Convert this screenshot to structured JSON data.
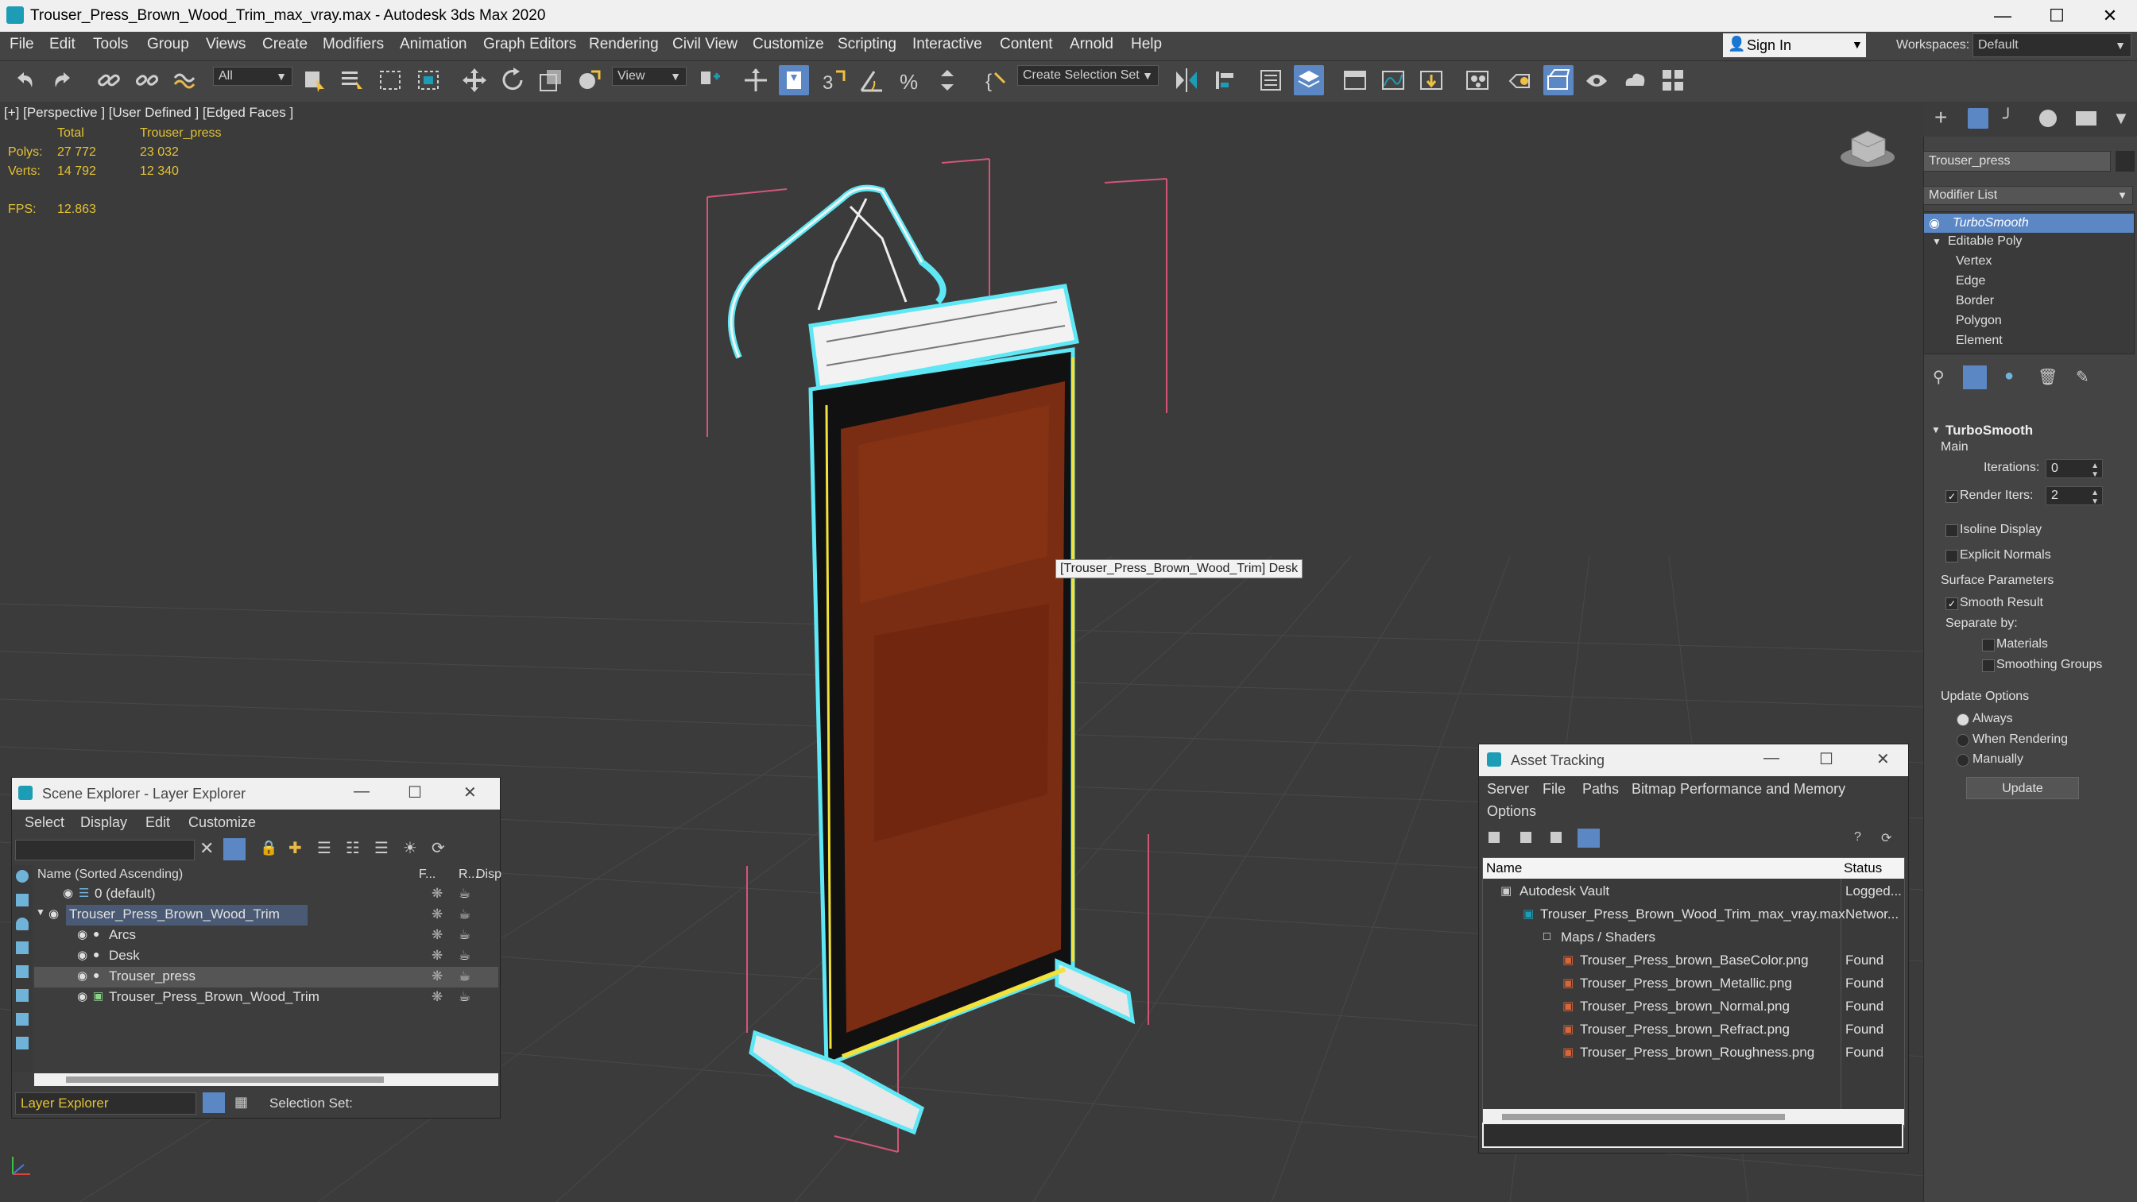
{
  "titlebar": {
    "title": "Trouser_Press_Brown_Wood_Trim_max_vray.max - Autodesk 3ds Max 2020"
  },
  "menu": [
    "File",
    "Edit",
    "Tools",
    "Group",
    "Views",
    "Create",
    "Modifiers",
    "Animation",
    "Graph Editors",
    "Rendering",
    "Civil View",
    "Customize",
    "Scripting",
    "Interactive",
    "Content",
    "Arnold",
    "Help"
  ],
  "account": {
    "sign_in": "Sign In",
    "workspaces_label": "Workspaces:",
    "workspace_value": "Default"
  },
  "toolbar": {
    "filter_value": "All",
    "ref_coord": "View",
    "selection_set_placeholder": "Create Selection Set"
  },
  "viewport": {
    "label": "[+] [Perspective ] [User Defined ] [Edged Faces ]",
    "stats": {
      "col_total": "Total",
      "col_object": "Trouser_press",
      "polys_label": "Polys:",
      "polys_total": "27 772",
      "polys_object": "23 032",
      "verts_label": "Verts:",
      "verts_total": "14 792",
      "verts_object": "12 340",
      "fps_label": "FPS:",
      "fps_value": "12.863"
    },
    "tooltip": "[Trouser_Press_Brown_Wood_Trim] Desk"
  },
  "command_panel": {
    "object_name": "Trouser_press",
    "modifier_list": "Modifier List",
    "stack": [
      "TurboSmooth",
      "Editable Poly",
      "Vertex",
      "Edge",
      "Border",
      "Polygon",
      "Element"
    ],
    "rollout_title": "TurboSmooth",
    "main_label": "Main",
    "iterations_label": "Iterations:",
    "iterations_value": "0",
    "render_iters_label": "Render Iters:",
    "render_iters_value": "2",
    "isoline_label": "Isoline Display",
    "explicit_normals_label": "Explicit Normals",
    "surface_params_label": "Surface Parameters",
    "smooth_result_label": "Smooth Result",
    "separate_by_label": "Separate by:",
    "materials_label": "Materials",
    "smoothing_groups_label": "Smoothing Groups",
    "update_options_label": "Update Options",
    "always_label": "Always",
    "when_rendering_label": "When Rendering",
    "manually_label": "Manually",
    "update_button": "Update"
  },
  "scene_explorer": {
    "title": "Scene Explorer - Layer Explorer",
    "menu": [
      "Select",
      "Display",
      "Edit",
      "Customize"
    ],
    "col_name": "Name (Sorted Ascending)",
    "col_f": "F...",
    "col_r": "R...",
    "col_disp": "Disp",
    "rows": [
      {
        "label": "0 (default)"
      },
      {
        "label": "Trouser_Press_Brown_Wood_Trim"
      },
      {
        "label": "Arcs"
      },
      {
        "label": "Desk"
      },
      {
        "label": "Trouser_press"
      },
      {
        "label": "Trouser_Press_Brown_Wood_Trim"
      }
    ],
    "footer_dropdown": "Layer Explorer",
    "selection_set_label": "Selection Set:"
  },
  "asset_tracking": {
    "title": "Asset Tracking",
    "menu": [
      "Server",
      "File",
      "Paths",
      "Bitmap Performance and Memory",
      "Options"
    ],
    "col_name": "Name",
    "col_status": "Status",
    "rows": [
      {
        "name": "Autodesk Vault",
        "status": "Logged..."
      },
      {
        "name": "Trouser_Press_Brown_Wood_Trim_max_vray.max",
        "status": "Networ..."
      },
      {
        "name": "Maps / Shaders",
        "status": ""
      },
      {
        "name": "Trouser_Press_brown_BaseColor.png",
        "status": "Found"
      },
      {
        "name": "Trouser_Press_brown_Metallic.png",
        "status": "Found"
      },
      {
        "name": "Trouser_Press_brown_Normal.png",
        "status": "Found"
      },
      {
        "name": "Trouser_Press_brown_Refract.png",
        "status": "Found"
      },
      {
        "name": "Trouser_Press_brown_Roughness.png",
        "status": "Found"
      }
    ]
  },
  "colors": {
    "accent_blue": "#5b87c5",
    "stat_yellow": "#e3c233",
    "wood": "#7a2d12",
    "selection_cyan": "#5ee8f5"
  }
}
